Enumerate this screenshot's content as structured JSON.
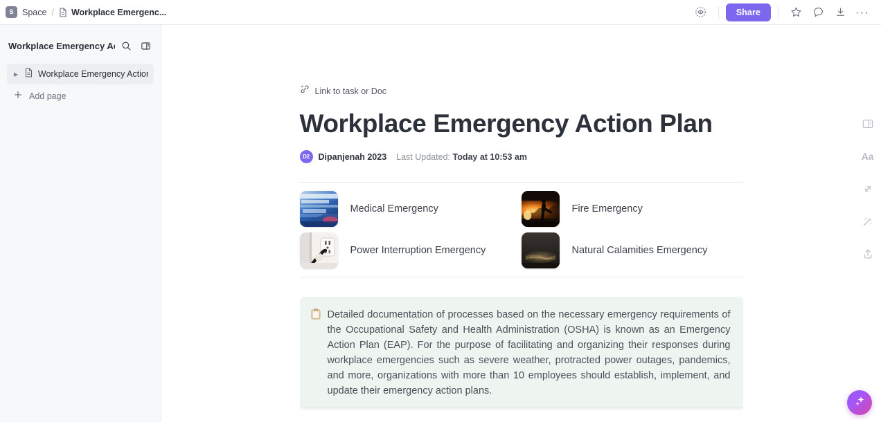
{
  "topbar": {
    "space_initial": "S",
    "space_label": "Space",
    "separator": "/",
    "doc_title": "Workplace Emergenc...",
    "share_label": "Share",
    "icons": {
      "privacy": "privacy-eye-icon",
      "star": "star-icon",
      "comment": "comment-icon",
      "import": "import-icon",
      "more": "more-options-icon"
    },
    "more_glyph": "···"
  },
  "sidebar": {
    "title": "Workplace Emergency Actio...",
    "search_icon": "search-icon",
    "panel_icon": "panel-toggle-icon",
    "items": [
      {
        "label": "Workplace Emergency Action ...",
        "icon": "doc-icon",
        "caret": "▶",
        "active": true
      }
    ],
    "add_page_label": "Add page",
    "add_page_icon": "plus-icon"
  },
  "doc": {
    "link_label": "Link to task or Doc",
    "link_icon": "link-task-icon",
    "title": "Workplace Emergency Action Plan",
    "author_initials": "D2",
    "author": "Dipanjenah 2023",
    "last_updated_prefix": "Last Updated:",
    "last_updated_value": "Today at 10:53 am",
    "cards": [
      {
        "label": "Medical Emergency",
        "thumb": "ambulance-photo"
      },
      {
        "label": "Fire Emergency",
        "thumb": "fire-photo"
      },
      {
        "label": "Power Interruption Emergency",
        "thumb": "outlet-plug-photo"
      },
      {
        "label": "Natural Calamities Emergency",
        "thumb": "night-storm-photo"
      }
    ],
    "callout": {
      "icon": "clipboard-icon",
      "text": "Detailed documentation of processes based on the necessary emergency requirements of the Occupational Safety and Health Administration (OSHA) is known as an Emergency Action Plan (EAP). For the purpose of facilitating and organizing their responses during workplace emergencies such as severe weather, protracted power outages, pandemics, and more, organizations with more than 10 employees should establish, implement, and update their emergency action plans."
    }
  },
  "rail": {
    "items": [
      {
        "name": "page-panel-icon",
        "glyph": ""
      },
      {
        "name": "font-size-icon",
        "glyph": "Aa"
      },
      {
        "name": "relationships-icon",
        "glyph": ""
      },
      {
        "name": "ai-wand-icon",
        "glyph": ""
      },
      {
        "name": "share-export-icon",
        "glyph": ""
      }
    ]
  },
  "ai_fab": {
    "icon": "ai-sparkle-icon"
  },
  "colors": {
    "brand_purple": "#7b68ee",
    "sidebar_bg": "#f7f8fa",
    "callout_bg": "#eef4f0",
    "divider": "#e9eaee"
  }
}
